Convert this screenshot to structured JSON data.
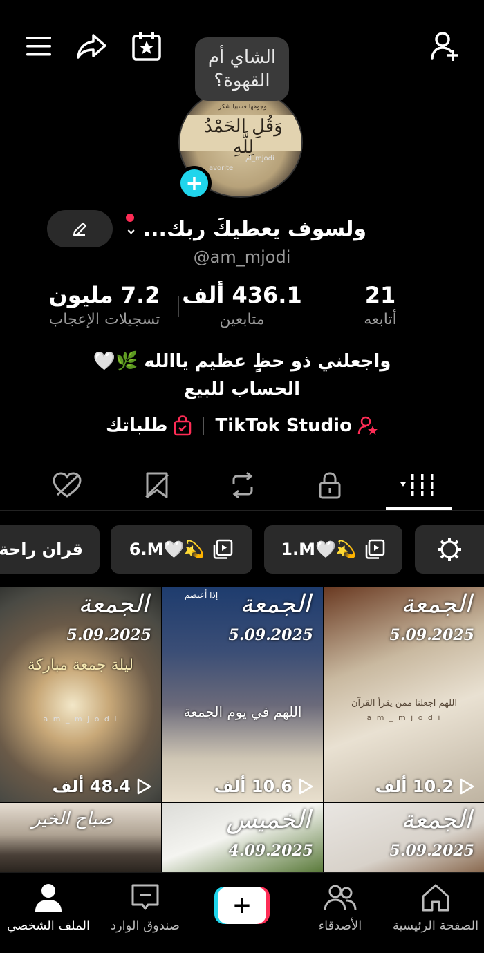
{
  "bubble": {
    "text": "الشاي أم القهوة؟"
  },
  "profile": {
    "name": "ولسوف يعطيكَ ربك...",
    "username": "@am_mjodi",
    "avatar_texts": [
      "وجوهها فسبيا شكر",
      "ام_mjodi",
      "avorite"
    ],
    "avatar_callig": "وَقُلِ الحَمْدُ لِلَّهِ"
  },
  "stats": [
    {
      "num": "21",
      "label": "أتابعه"
    },
    {
      "num": "436.1 ألف",
      "label": "متابعين"
    },
    {
      "num": "7.2 مليون",
      "label": "تسجيلات الإعجاب"
    }
  ],
  "bio": {
    "line1": "واجعلني ذو حظٍ عظيم ياالله 🌿🤍",
    "line2": "الحساب للبيع"
  },
  "links": {
    "studio": "TikTok Studio",
    "orders": "طلباتك"
  },
  "collections": [
    {
      "label": "1.M🤍💫"
    },
    {
      "label": "6.M🤍💫"
    },
    {
      "label": "قران راحة"
    }
  ],
  "tiles": [
    {
      "heading": "الجمعة",
      "date": "5.09.2025",
      "views": "10.2 ألف",
      "mid": "اللهم اجعلنا ممن يقرأ القرآن",
      "watermark": "a m _ m j o d i"
    },
    {
      "heading": "الجمعة",
      "date": "5.09.2025",
      "views": "10.6 ألف",
      "mid": "اللهم في يوم الجمعة",
      "watermark": "إذا أعتصم"
    },
    {
      "heading": "الجمعة",
      "date": "5.09.2025",
      "views": "48.4 ألف",
      "mid": "ليلة جمعة مباركة",
      "watermark": "a m _ m j o d i"
    },
    {
      "heading": "الجمعة",
      "date": "5.09.2025"
    },
    {
      "heading": "الخميس",
      "date": "4.09.2025"
    },
    {
      "heading": "صباح الخير",
      "date": ""
    }
  ],
  "nav": {
    "home": "الصفحة الرئيسية",
    "friends": "الأصدقاء",
    "inbox": "صندوق الوارد",
    "profile": "الملف الشخصي"
  },
  "colors": {
    "accent": "#fe2c55",
    "cyan": "#20d5ec"
  }
}
